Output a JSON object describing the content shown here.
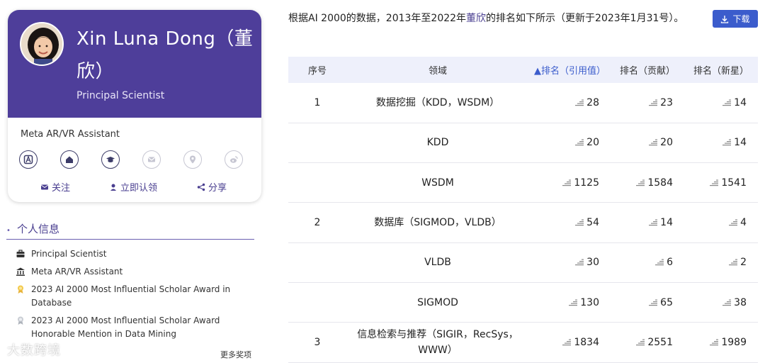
{
  "profile": {
    "name": "Xin Luna Dong（董欣）",
    "title": "Principal Scientist",
    "org": "Meta AR/VR Assistant",
    "icons": [
      "aminer-icon",
      "homepage-icon",
      "education-icon",
      "email-icon",
      "location-icon",
      "weibo-icon"
    ],
    "actions": {
      "follow": "关注",
      "claim": "立即认领",
      "share": "分享"
    }
  },
  "info": {
    "section_title": "个人信息",
    "items": [
      {
        "icon": "briefcase-icon",
        "text": "Principal Scientist"
      },
      {
        "icon": "institution-icon",
        "text": "Meta AR/VR Assistant"
      },
      {
        "icon": "award-gold-icon",
        "text": "2023 AI 2000 Most Influential Scholar Award in Database"
      },
      {
        "icon": "award-silver-icon",
        "text": "2023 AI 2000 Most Influential Scholar Award Honorable Mention in Data Mining"
      }
    ],
    "more_awards": "更多奖项"
  },
  "watermark": "大数跨境",
  "ranking": {
    "description_prefix": "根据AI 2000的数据，2013年至2022年",
    "description_name": "董欣",
    "description_suffix": "的排名如下所示（更新于2023年1月31号）。",
    "download_label": "下载",
    "headers": [
      "序号",
      "领域",
      "排名（引用值）",
      "排名（贡献）",
      "排名（新星）"
    ],
    "rows": [
      {
        "seq": "1",
        "field": "数据挖掘（KDD，WSDM）",
        "citation": "28",
        "contribution": "23",
        "rising": "14"
      },
      {
        "seq": "",
        "field": "KDD",
        "citation": "20",
        "contribution": "20",
        "rising": "14"
      },
      {
        "seq": "",
        "field": "WSDM",
        "citation": "1125",
        "contribution": "1584",
        "rising": "1541"
      },
      {
        "seq": "2",
        "field": "数据库（SIGMOD，VLDB）",
        "citation": "54",
        "contribution": "14",
        "rising": "4"
      },
      {
        "seq": "",
        "field": "VLDB",
        "citation": "30",
        "contribution": "6",
        "rising": "2"
      },
      {
        "seq": "",
        "field": "SIGMOD",
        "citation": "130",
        "contribution": "65",
        "rising": "38"
      },
      {
        "seq": "3",
        "field": "信息检索与推荐（SIGIR，RecSys，WWW）",
        "citation": "1834",
        "contribution": "2551",
        "rising": "1989"
      }
    ]
  },
  "colors": {
    "brand_purple": "#4e3e9a",
    "accent_blue": "#3b5ccc",
    "header_bg": "#eef0fb"
  }
}
